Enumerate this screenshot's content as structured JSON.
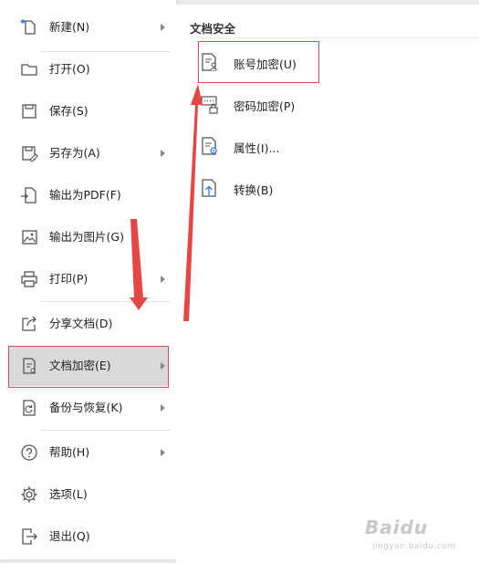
{
  "menu": {
    "items": [
      {
        "label": "新建(N)",
        "icon": "new-file-icon"
      },
      {
        "label": "打开(O)",
        "icon": "folder-open-icon"
      },
      {
        "label": "保存(S)",
        "icon": "save-icon"
      },
      {
        "label": "另存为(A)",
        "icon": "save-as-icon"
      },
      {
        "label": "输出为PDF(F)",
        "icon": "export-pdf-icon"
      },
      {
        "label": "输出为图片(G)",
        "icon": "export-image-icon"
      },
      {
        "label": "打印(P)",
        "icon": "printer-icon"
      },
      {
        "label": "分享文档(D)",
        "icon": "share-icon"
      },
      {
        "label": "文档加密(E)",
        "icon": "document-encrypt-icon"
      },
      {
        "label": "备份与恢复(K)",
        "icon": "backup-restore-icon"
      },
      {
        "label": "帮助(H)",
        "icon": "help-icon"
      },
      {
        "label": "选项(L)",
        "icon": "settings-gear-icon"
      },
      {
        "label": "退出(Q)",
        "icon": "exit-icon"
      }
    ]
  },
  "submenu": {
    "title": "文档安全",
    "items": [
      {
        "label": "账号加密(U)",
        "icon": "account-lock-icon"
      },
      {
        "label": "密码加密(P)",
        "icon": "password-lock-icon"
      },
      {
        "label": "属性(I)...",
        "icon": "properties-icon"
      },
      {
        "label": "转换(B)",
        "icon": "convert-icon"
      }
    ]
  },
  "watermark": {
    "brand": "Baidu",
    "site": "jingyan.baidu.com"
  },
  "colors": {
    "annotation_red": "#e04a4a",
    "active_bg": "#d9d9d9",
    "icon": "#555555"
  }
}
